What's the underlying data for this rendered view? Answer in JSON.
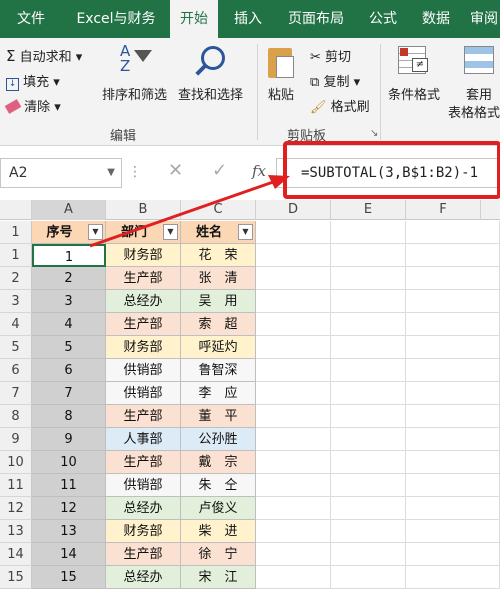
{
  "tabs": [
    "文件",
    "Excel与财务",
    "开始",
    "插入",
    "页面布局",
    "公式",
    "数据",
    "审阅"
  ],
  "ribbon": {
    "autosum": "自动求和",
    "fill": "填充",
    "clear": "清除",
    "sortfilter": "排序和筛选",
    "findselect": "查找和选择",
    "edit_group": "编辑",
    "paste": "粘贴",
    "cut": "剪切",
    "copy": "复制",
    "formatpainter": "格式刷",
    "clipboard_group": "剪贴板",
    "condformat": "条件格式",
    "tableformat1": "套用",
    "tableformat2": "表格格式"
  },
  "namebox": "A2",
  "formula": "=SUBTOTAL(3,B$1:B2)-1",
  "fx": "fx",
  "columns": [
    "A",
    "B",
    "C",
    "D",
    "E",
    "F"
  ],
  "headers": [
    "序号",
    "部门",
    "姓名"
  ],
  "rows": [
    {
      "n": "1",
      "no": "1",
      "dept": "财务部",
      "name": "花　荣"
    },
    {
      "n": "2",
      "no": "2",
      "dept": "生产部",
      "name": "张　清"
    },
    {
      "n": "3",
      "no": "3",
      "dept": "总经办",
      "name": "吴　用"
    },
    {
      "n": "4",
      "no": "4",
      "dept": "生产部",
      "name": "索　超"
    },
    {
      "n": "5",
      "no": "5",
      "dept": "财务部",
      "name": "呼延灼"
    },
    {
      "n": "6",
      "no": "6",
      "dept": "供销部",
      "name": "鲁智深"
    },
    {
      "n": "7",
      "no": "7",
      "dept": "供销部",
      "name": "李　应"
    },
    {
      "n": "8",
      "no": "8",
      "dept": "生产部",
      "name": "董　平"
    },
    {
      "n": "9",
      "no": "9",
      "dept": "人事部",
      "name": "公孙胜"
    },
    {
      "n": "10",
      "no": "10",
      "dept": "生产部",
      "name": "戴　宗"
    },
    {
      "n": "11",
      "no": "11",
      "dept": "供销部",
      "name": "朱　仝"
    },
    {
      "n": "12",
      "no": "12",
      "dept": "总经办",
      "name": "卢俊义"
    },
    {
      "n": "13",
      "no": "13",
      "dept": "财务部",
      "name": "柴　进"
    },
    {
      "n": "14",
      "no": "14",
      "dept": "生产部",
      "name": "徐　宁"
    },
    {
      "n": "15",
      "no": "15",
      "dept": "总经办",
      "name": "宋　江"
    }
  ],
  "header_row_num": "1",
  "colors": {
    "accent": "#217346",
    "财务部": "#fff2cc",
    "生产部": "#fbe1d1",
    "总经办": "#e2efda",
    "供销部": "#f7f7f7",
    "人事部": "#ddebf7",
    "selection": "#d0d0d0",
    "highlight": "#e02020"
  }
}
